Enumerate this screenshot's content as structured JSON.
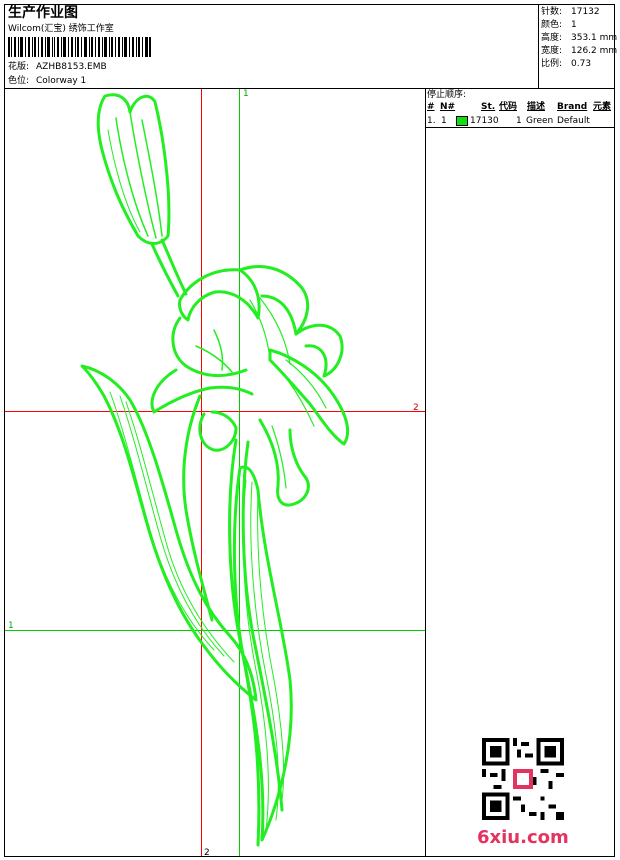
{
  "header": {
    "title": "生产作业图",
    "studio": "Wilcom(汇宝) 绣饰工作室",
    "design_label": "花版:",
    "design_value": "AZHB8153.EMB",
    "colorway_label": "色位:",
    "colorway_value": "Colorway 1"
  },
  "stats": [
    {
      "label": "针数:",
      "value": "17132"
    },
    {
      "label": "颜色:",
      "value": "1"
    },
    {
      "label": "高度:",
      "value": "353.1 mm"
    },
    {
      "label": "宽度:",
      "value": "126.2 mm"
    },
    {
      "label": "比例:",
      "value": "0.73"
    }
  ],
  "stop_sequence": {
    "title": "停止顺序:",
    "columns": [
      "#",
      "N#",
      "St.",
      "代码",
      "描述",
      "Brand",
      "元素"
    ],
    "rows": [
      {
        "index": "1.",
        "n": "1",
        "swatch": "#11dd11",
        "stitches": "17130",
        "code": "1",
        "description": "Green",
        "brand": "Default",
        "element": ""
      }
    ]
  },
  "guides": {
    "v1_label": "1",
    "h2_label": "2",
    "h1_label": "1",
    "v2_label": "2"
  },
  "colors": {
    "design": "#22ee22",
    "guide_green": "#00cc00",
    "guide_red": "#ff0000"
  },
  "watermark": "6xiu.com"
}
